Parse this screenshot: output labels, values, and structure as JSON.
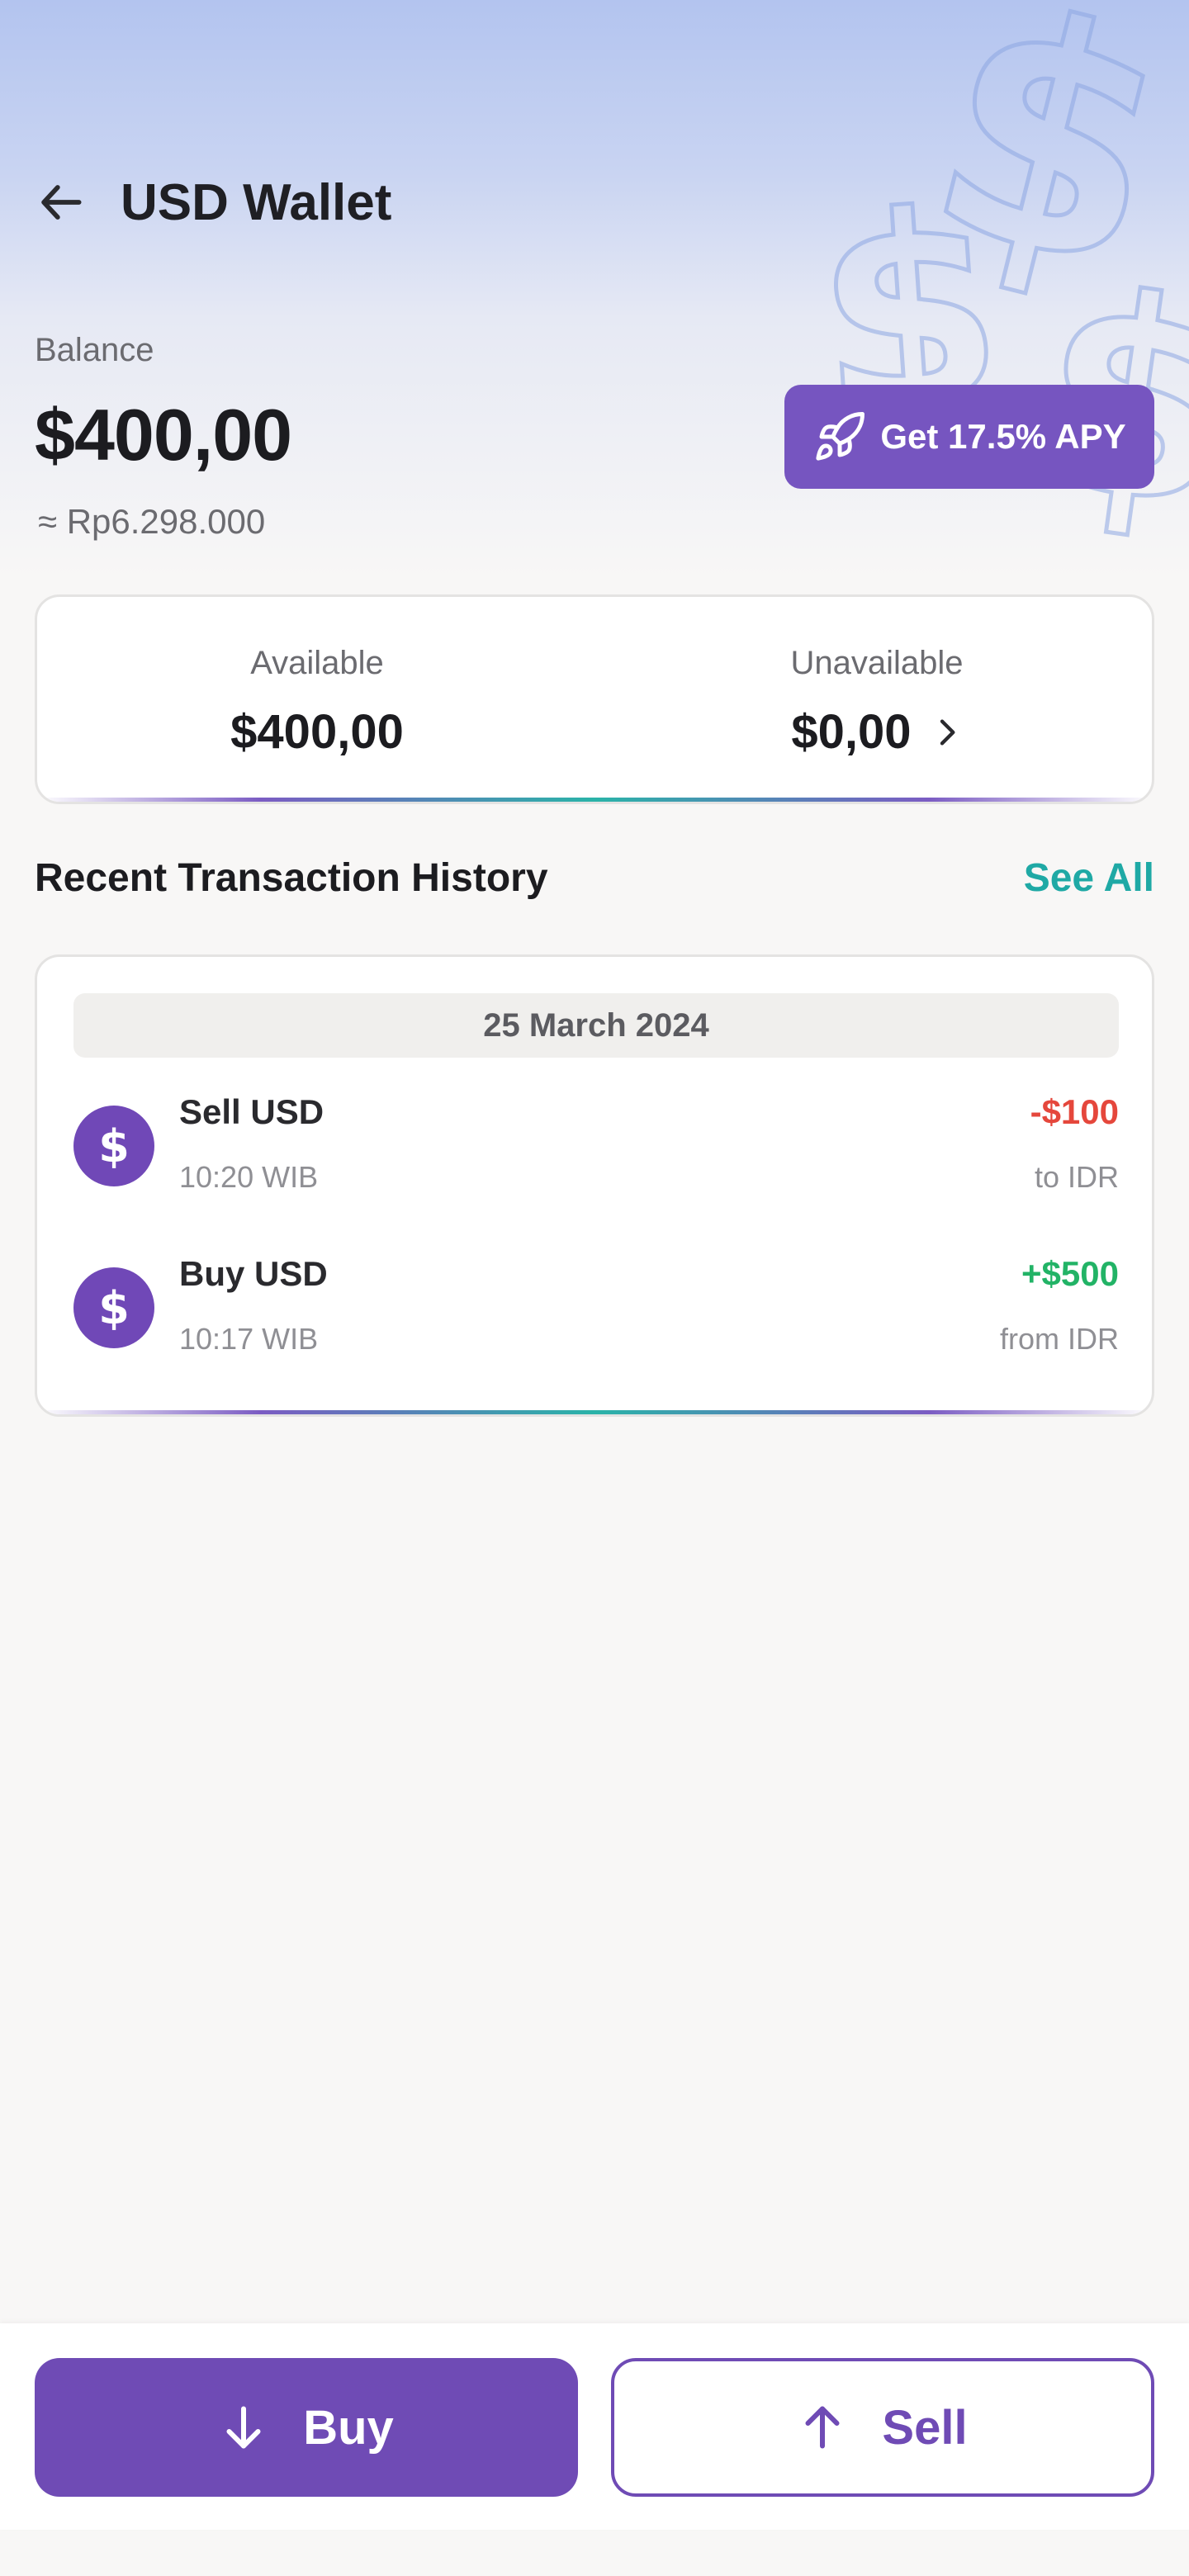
{
  "header": {
    "title": "USD Wallet",
    "back_icon": "arrow-left-icon"
  },
  "balance": {
    "label": "Balance",
    "value": "$400,00",
    "idr_equivalent": "≈ Rp6.298.000"
  },
  "apy_button": {
    "label": "Get 17.5% APY",
    "icon": "rocket-icon"
  },
  "availability": {
    "available": {
      "label": "Available",
      "value": "$400,00"
    },
    "unavailable": {
      "label": "Unavailable",
      "value": "$0,00",
      "icon": "chevron-right-icon"
    }
  },
  "transactions": {
    "title": "Recent Transaction History",
    "see_all": "See All",
    "date": "25 March 2024",
    "items": [
      {
        "name": "Sell USD",
        "time": "10:20 WIB",
        "amount": "-$100",
        "sub": "to IDR",
        "icon_glyph": "$",
        "amount_color": "#e5473c"
      },
      {
        "name": "Buy USD",
        "time": "10:17 WIB",
        "amount": "+$500",
        "sub": "from IDR",
        "icon_glyph": "$",
        "amount_color": "#22b366"
      }
    ]
  },
  "actions": {
    "buy": "Buy",
    "sell": "Sell"
  },
  "colors": {
    "primary": "#6f4bb5",
    "accent": "#1fa9a5",
    "negative": "#e5473c",
    "positive": "#22b366"
  }
}
